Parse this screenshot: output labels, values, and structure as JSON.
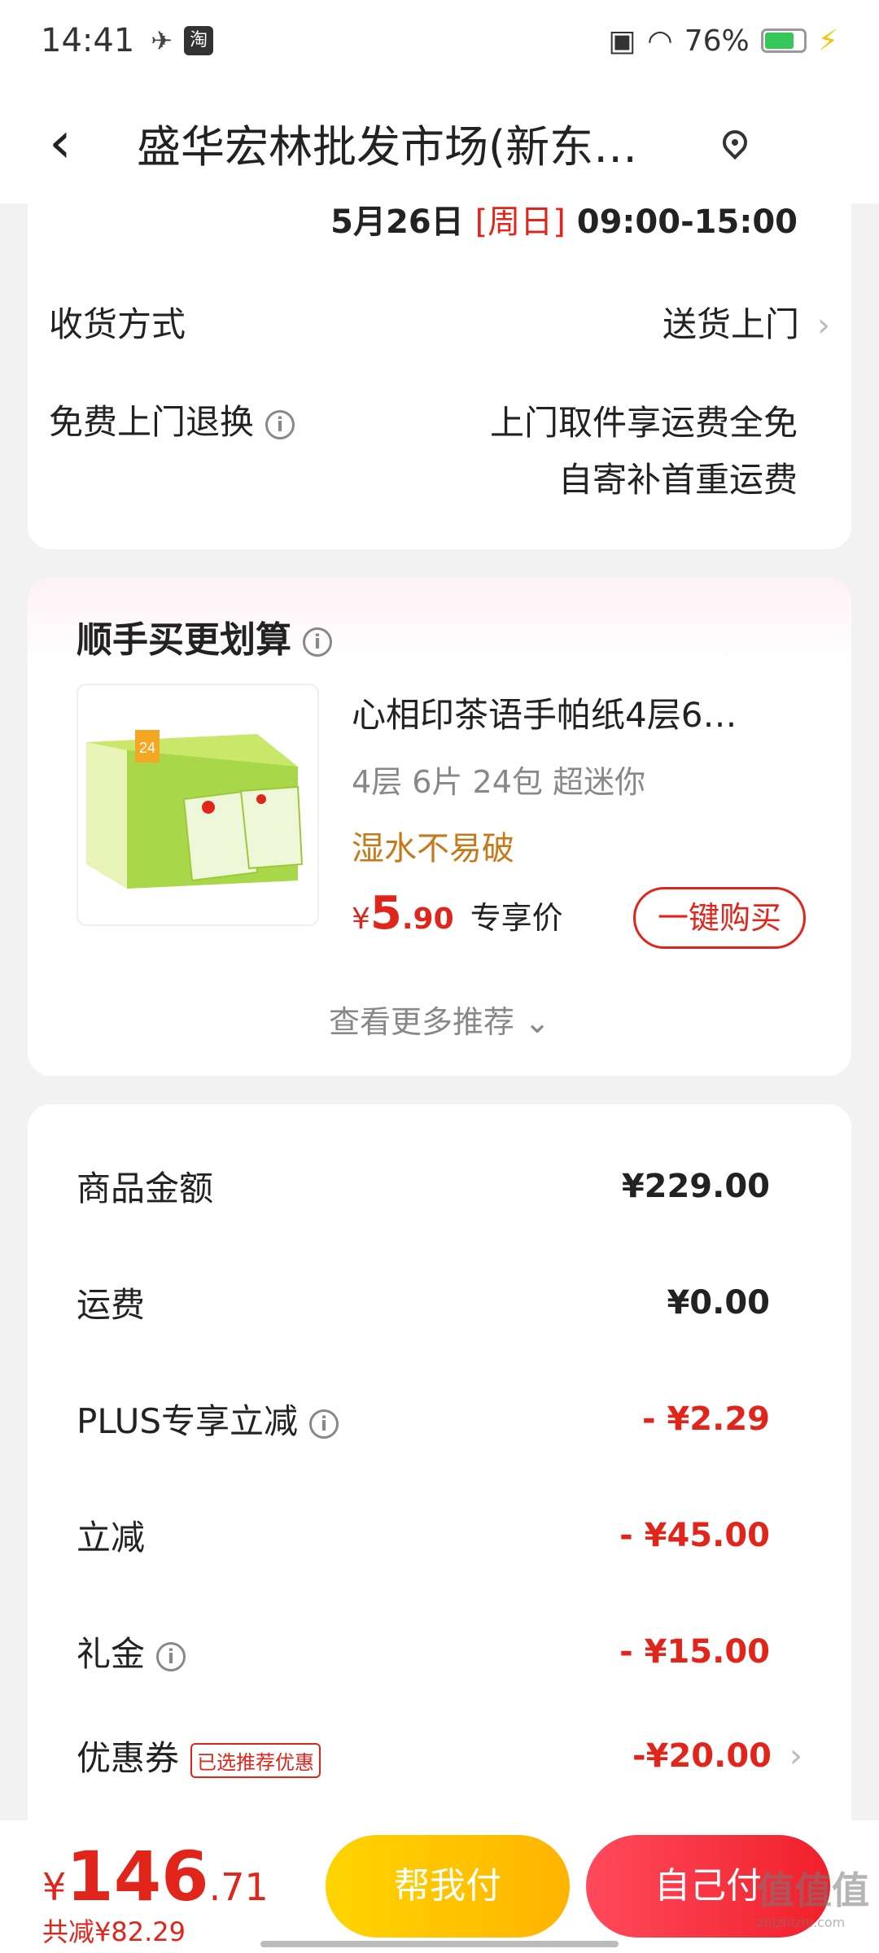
{
  "status_bar": {
    "time": "14:41",
    "taobao_icon": "淘",
    "battery": "76%",
    "battery_level": 0.76
  },
  "nav": {
    "title": "盛华宏林批发市场(新东…"
  },
  "delivery": {
    "date": "5月26日",
    "weekday": "[周日]",
    "time_range": "09:00-15:00",
    "method_label": "收货方式",
    "method_value": "送货上门",
    "return_label": "免费上门退换",
    "return_line1": "上门取件享运费全免",
    "return_line2": "自寄补首重运费"
  },
  "recommend": {
    "title": "顺手买更划算",
    "product_name": "心相印茶语手帕纸4层6…",
    "spec": "4层 6片 24包 超迷你",
    "tag": "湿水不易破",
    "price_symbol": "¥",
    "price_int": "5",
    "price_dec": ".90",
    "price_label": "专享价",
    "buy_button": "一键购买",
    "more": "查看更多推荐"
  },
  "summary": {
    "goods_label": "商品金额",
    "goods_value": "¥229.00",
    "shipping_label": "运费",
    "shipping_value": "¥0.00",
    "plus_label": "PLUS专享立减",
    "plus_value": "- ¥2.29",
    "discount_label": "立减",
    "discount_value": "- ¥45.00",
    "gift_label": "礼金",
    "gift_value": "- ¥15.00",
    "coupon_label": "优惠券",
    "coupon_badge": "已选推荐优惠",
    "coupon_value": "-¥20.00"
  },
  "bottom": {
    "total_symbol": "¥",
    "total_int": "146",
    "total_dec": ".71",
    "saved": "共减¥82.29",
    "help_pay": "帮我付",
    "self_pay": "自己付",
    "watermark": "值值值",
    "watermark_sub": "zhizhizhi.com"
  },
  "colors": {
    "accent": "#e1251b",
    "tag": "#c47a1a",
    "help_pay": "#ffc400",
    "self_pay": "#f0303a"
  }
}
